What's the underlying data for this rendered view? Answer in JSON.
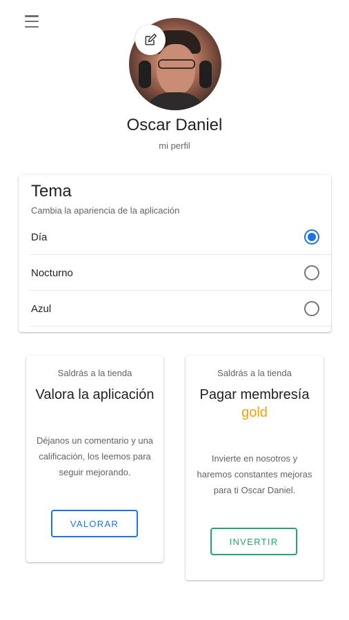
{
  "header": {
    "menu_icon": "menu-icon"
  },
  "profile": {
    "name": "Oscar Daniel",
    "subtitle": "mi perfil",
    "edit_icon": "edit-icon"
  },
  "theme": {
    "title": "Tema",
    "description": "Cambia la apariencia de la aplicación",
    "options": [
      {
        "label": "Día",
        "selected": true
      },
      {
        "label": "Nocturno",
        "selected": false
      },
      {
        "label": "Azul",
        "selected": false
      }
    ]
  },
  "cards": {
    "rate": {
      "overline": "Saldrás a la tienda",
      "title": "Valora la aplicación",
      "body": "Déjanos un comentario y una calificación, los leemos para seguir mejorando.",
      "button": "VALORAR",
      "color": "#1a73e8"
    },
    "membership": {
      "overline": "Saldrás a la tienda",
      "title": "Pagar membresía",
      "title_accent": "gold",
      "body": "Invierte en nosotros y haremos constantes mejoras para ti Oscar Daniel.",
      "button": "INVERTIR",
      "color": "#1ea868",
      "accent_color": "#f0a30a"
    }
  }
}
